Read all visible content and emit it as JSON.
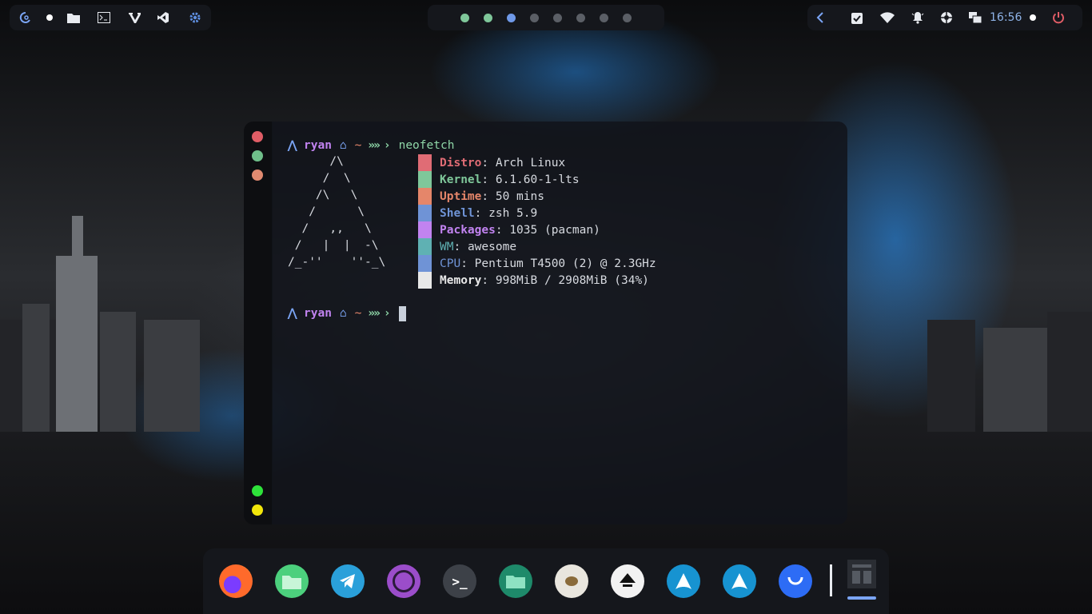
{
  "topbar": {
    "left_icons": [
      "debian-swirl-icon",
      "dot-icon",
      "folder-icon",
      "terminal-icon",
      "vim-icon",
      "vscode-icon",
      "gear-icon"
    ],
    "workspaces": [
      {
        "active": true,
        "color": "#7fc79a"
      },
      {
        "active": true,
        "color": "#7fc79a"
      },
      {
        "active": true,
        "color": "#6f99e8"
      },
      {
        "active": false,
        "color": "#5b5f66"
      },
      {
        "active": false,
        "color": "#5b5f66"
      },
      {
        "active": false,
        "color": "#5b5f66"
      },
      {
        "active": false,
        "color": "#5b5f66"
      },
      {
        "active": false,
        "color": "#5b5f66"
      }
    ],
    "right_icons": [
      "chevron-left-icon",
      "clipboard-check-icon",
      "wifi-icon",
      "bell-icon",
      "aperture-icon",
      "windows-icon"
    ],
    "clock": "16:56",
    "power_icon": "power-icon"
  },
  "terminal": {
    "window_dots": [
      "#e05d66",
      "#6fbf8a",
      "#e08a70",
      "#2ee23a",
      "#f2e60a"
    ],
    "prompt": {
      "user": "ryan",
      "dir": "~",
      "command": "neofetch"
    },
    "ascii_logo": [
      "      /\\",
      "     /  \\",
      "    /\\   \\",
      "   /      \\",
      "  /   ,,   \\",
      " /   |  |  -\\",
      "/_-''    ''-_\\"
    ],
    "info": [
      {
        "key": "Distro",
        "value": "Arch Linux",
        "color": "#e06c75"
      },
      {
        "key": "Kernel",
        "value": "6.1.60-1-lts",
        "color": "#7fc79a"
      },
      {
        "key": "Uptime",
        "value": "50 mins",
        "color": "#e5866a"
      },
      {
        "key": "Shell",
        "value": "zsh 5.9",
        "color": "#6f93d6"
      },
      {
        "key": "Packages",
        "value": "1035 (pacman)",
        "color": "#c183f0"
      },
      {
        "key": "WM",
        "value": "awesome",
        "color": "#5fb1b3"
      },
      {
        "key": "CPU",
        "value": "Pentium T4500 (2) @ 2.3GHz",
        "color": "#6f93d6"
      },
      {
        "key": "Memory",
        "value": "998MiB / 2908MiB (34%)",
        "color": "#e8e8e8"
      }
    ]
  },
  "dock": {
    "apps": [
      {
        "name": "firefox",
        "color": "#ff7a1a"
      },
      {
        "name": "files",
        "color": "#4cd07d"
      },
      {
        "name": "telegram",
        "color": "#2aa0da"
      },
      {
        "name": "obs",
        "color": "#9b4dca"
      },
      {
        "name": "terminal",
        "color": "#3d4148"
      },
      {
        "name": "file-manager",
        "color": "#1e8a6a"
      },
      {
        "name": "gimp",
        "color": "#e9e6de"
      },
      {
        "name": "inkscape",
        "color": "#f2f2f2"
      },
      {
        "name": "arch-1",
        "color": "#1793d1"
      },
      {
        "name": "arch-2",
        "color": "#1793d1"
      },
      {
        "name": "store",
        "color": "#2d6cf5"
      }
    ]
  }
}
